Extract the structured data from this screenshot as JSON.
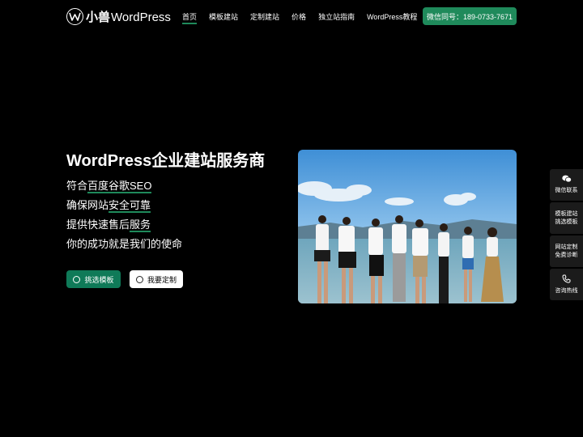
{
  "header": {
    "logo": {
      "brand": "小兽",
      "suffix": "WordPress"
    },
    "nav": [
      "首页",
      "模板建站",
      "定制建站",
      "价格",
      "独立站指南",
      "WordPress教程"
    ],
    "phone_button": "微信同号：189-0733-7671"
  },
  "hero": {
    "title": "WordPress企业建站服务商",
    "features": [
      {
        "pre": "符合",
        "hl": "百度谷歌SEO",
        "post": ""
      },
      {
        "pre": "确保网站",
        "hl": "安全可靠",
        "post": ""
      },
      {
        "pre": "提供快速售后",
        "hl": "服务",
        "post": ""
      },
      {
        "pre": "你的成功就是我们的使命",
        "hl": "",
        "post": ""
      }
    ],
    "primary_button": "挑选模板",
    "secondary_button": "我要定制"
  },
  "side_panel": [
    {
      "icon": "wechat-icon",
      "lines": [
        "微信联系"
      ]
    },
    {
      "icon": "",
      "lines": [
        "模板建站",
        "挑选模板"
      ]
    },
    {
      "icon": "",
      "lines": [
        "网站定制",
        "免费诊断"
      ]
    },
    {
      "icon": "phone-icon",
      "lines": [
        "咨询热线"
      ]
    }
  ],
  "colors": {
    "accent": "#1f8a5b",
    "button_primary": "#0f7a58",
    "background": "#000000"
  }
}
